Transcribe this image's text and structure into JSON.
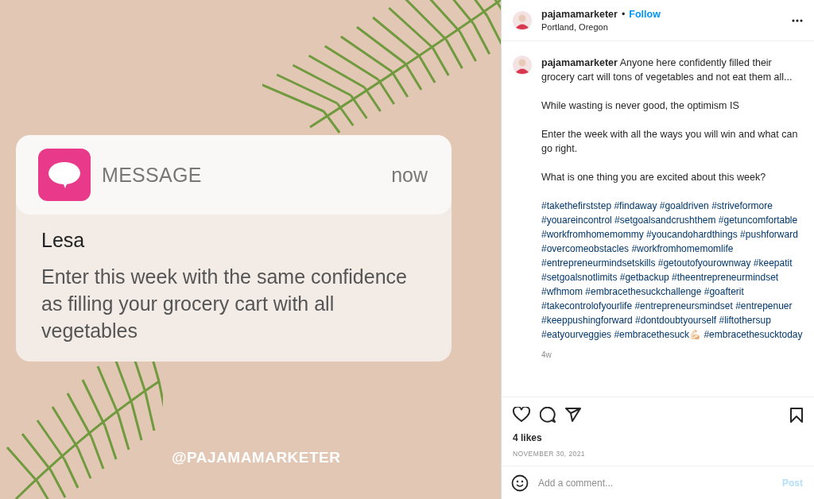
{
  "post_image": {
    "notification": {
      "app": "MESSAGE",
      "time": "now",
      "sender": "Lesa",
      "message": "Enter this week with the same confidence as filling your grocery cart with all vegetables"
    },
    "handle": "@PAJAMAMARKETER"
  },
  "header": {
    "username": "pajamamarketer",
    "separator": "•",
    "follow": "Follow",
    "location": "Portland, Oregon"
  },
  "caption": {
    "paragraphs": [
      "**pajamamarketer** Anyone here confidently filled their grocery cart will tons of vegetables and not eat them all...",
      "While wasting is never good, the optimism IS",
      "Enter the week with all the ways you will win and what can go right.",
      "What is one thing you are excited about this week?"
    ],
    "hashtag_lines": [
      "#takethefirststep #findaway #goaldriven #striveformore",
      "#youareincontrol #setgoalsandcrushthem #getuncomfortable",
      "#workfromhomemommy #youcandohardthings #pushforward",
      "#overcomeobstacles #workfromhomemomlife",
      "#entrepreneurmindsetskills #getoutofyourownway #keepatit",
      "#setgoalsnotlimits #getbackup #theentrepreneurmindset",
      "#wfhmom #embracethesuckchallenge #goafterit",
      "#takecontrolofyourlife #entrepreneursmindset #entrepenuer",
      "#keeppushingforward #dontdoubtyourself #liftothersup",
      "#eatyourveggies #embracethesuck💪🏻 #embracethesucktoday"
    ],
    "age": "4w"
  },
  "likes": "4 likes",
  "date": "NOVEMBER 30, 2021",
  "comment": {
    "placeholder": "Add a comment...",
    "post": "Post",
    "post_disabled": true
  }
}
